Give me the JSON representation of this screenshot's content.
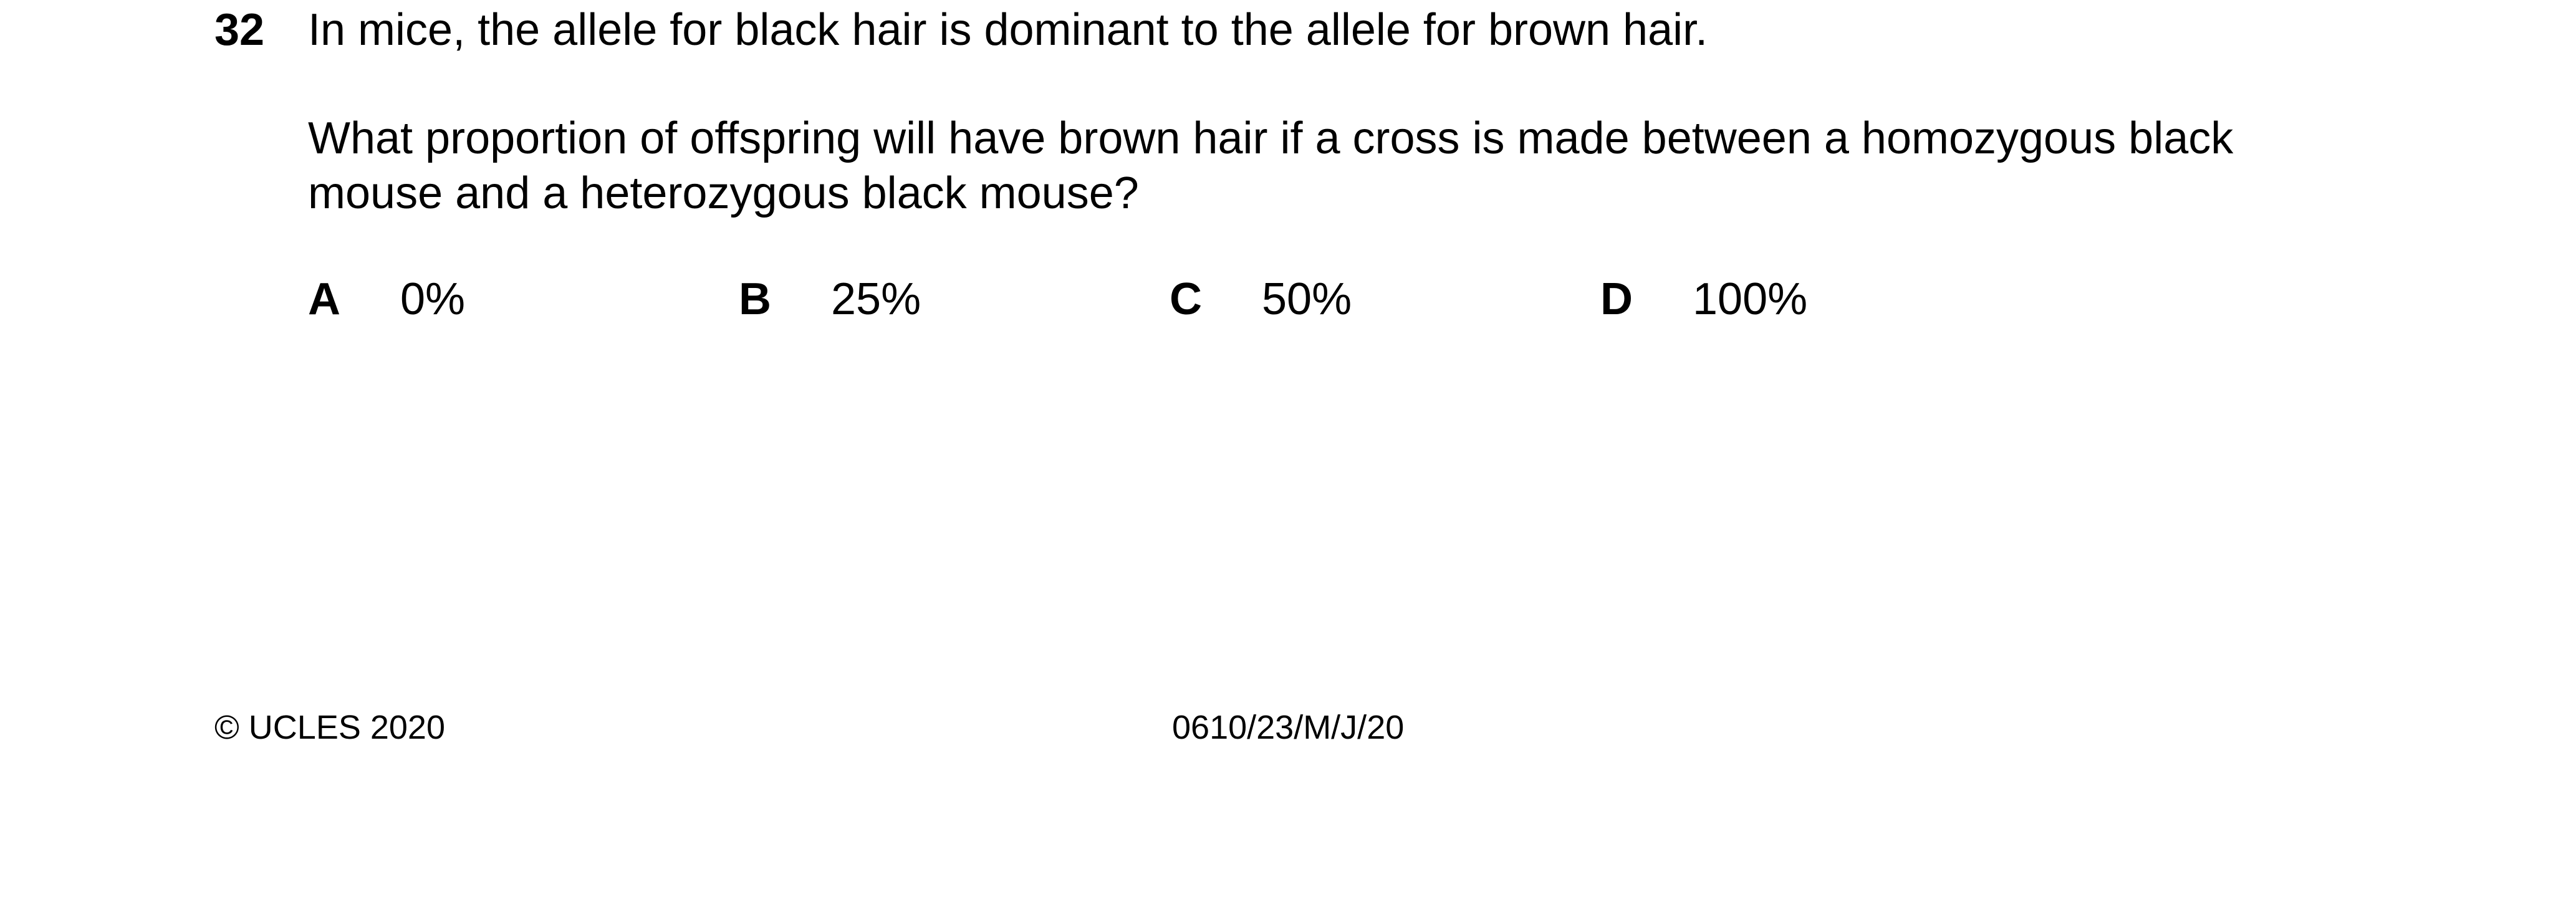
{
  "question": {
    "number": "32",
    "stem": "In mice, the allele for black hair is dominant to the allele for brown hair.",
    "prompt_lines": [
      "What proportion of offspring will have brown hair if a cross is made between a homozygous black",
      "mouse and a heterozygous black mouse?"
    ],
    "options": [
      {
        "letter": "A",
        "value": "0%"
      },
      {
        "letter": "B",
        "value": "25%"
      },
      {
        "letter": "C",
        "value": "50%"
      },
      {
        "letter": "D",
        "value": "100%"
      }
    ]
  },
  "footer": {
    "copyright": "© UCLES 2020",
    "paper_code": "0610/23/M/J/20"
  }
}
